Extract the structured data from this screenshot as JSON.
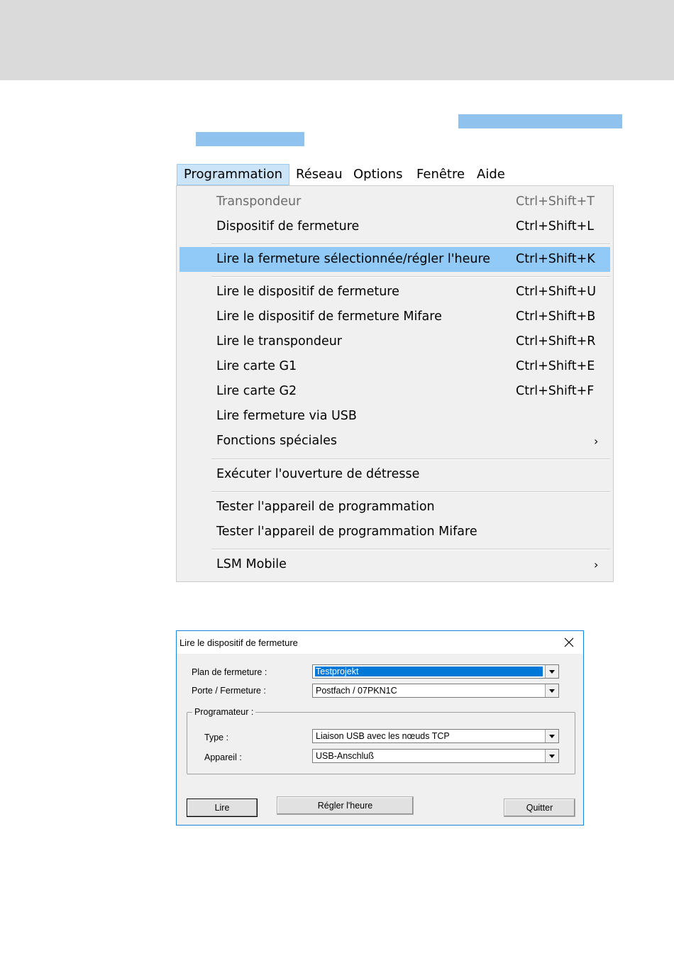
{
  "menubar": {
    "items": [
      "Programmation",
      "Réseau",
      "Options",
      "Fenêtre",
      "Aide"
    ]
  },
  "menu": {
    "items": [
      {
        "label": "Transpondeur",
        "shortcut": "Ctrl+Shift+T"
      },
      {
        "label": "Dispositif de fermeture",
        "shortcut": "Ctrl+Shift+L"
      },
      {
        "label": "Lire la fermeture sélectionnée/régler l'heure",
        "shortcut": "Ctrl+Shift+K"
      },
      {
        "label": "Lire le dispositif de fermeture",
        "shortcut": "Ctrl+Shift+U"
      },
      {
        "label": "Lire le dispositif de fermeture Mifare",
        "shortcut": "Ctrl+Shift+B"
      },
      {
        "label": "Lire le transpondeur",
        "shortcut": "Ctrl+Shift+R"
      },
      {
        "label": "Lire carte G1",
        "shortcut": "Ctrl+Shift+E"
      },
      {
        "label": "Lire carte G2",
        "shortcut": "Ctrl+Shift+F"
      },
      {
        "label": "Lire fermeture via USB",
        "shortcut": ""
      },
      {
        "label": "Fonctions spéciales",
        "shortcut": ""
      },
      {
        "label": "Exécuter l'ouverture de détresse",
        "shortcut": ""
      },
      {
        "label": "Tester l'appareil de programmation",
        "shortcut": ""
      },
      {
        "label": "Tester l'appareil de programmation Mifare",
        "shortcut": ""
      },
      {
        "label": "LSM Mobile",
        "shortcut": ""
      }
    ],
    "submenu_arrow": "›"
  },
  "dialog": {
    "title": "Lire le dispositif de fermeture",
    "plan_label": "Plan de fermeture :",
    "plan_value": "Testprojekt",
    "door_label": "Porte / Fermeture :",
    "door_value": "Postfach / 07PKN1C",
    "group_label": "Programateur :",
    "type_label": "Type :",
    "type_value": "Liaison USB avec les nœuds TCP",
    "device_label": "Appareil :",
    "device_value": "USB-Anschluß",
    "buttons": {
      "read": "Lire",
      "set_time": "Régler l'heure",
      "quit": "Quitter"
    }
  },
  "colors": {
    "highlight_bar": "#8fc3ee",
    "menu_selected": "#91c9f7",
    "menubar_open": "#cce4f7",
    "combo_selected": "#0078d7",
    "dialog_border": "#1883d7",
    "top_band": "#dadada"
  }
}
